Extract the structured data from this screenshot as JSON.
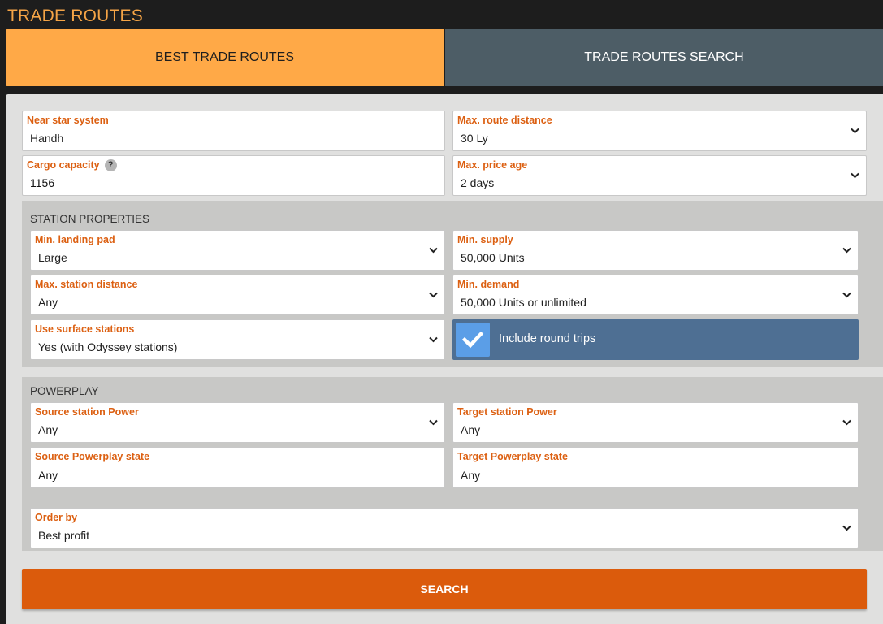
{
  "page_title": "TRADE ROUTES",
  "tabs": {
    "best": "BEST TRADE ROUTES",
    "search": "TRADE ROUTES SEARCH"
  },
  "form": {
    "near_star_system": {
      "label": "Near star system",
      "value": "Handh"
    },
    "max_route_distance": {
      "label": "Max. route distance",
      "value": "30 Ly"
    },
    "cargo_capacity": {
      "label": "Cargo capacity",
      "value": "1156",
      "help": "?"
    },
    "max_price_age": {
      "label": "Max. price age",
      "value": "2 days"
    }
  },
  "station_properties": {
    "title": "STATION PROPERTIES",
    "min_landing_pad": {
      "label": "Min. landing pad",
      "value": "Large"
    },
    "min_supply": {
      "label": "Min. supply",
      "value": "50,000 Units"
    },
    "max_station_distance": {
      "label": "Max. station distance",
      "value": "Any"
    },
    "min_demand": {
      "label": "Min. demand",
      "value": "50,000 Units or unlimited"
    },
    "use_surface_stations": {
      "label": "Use surface stations",
      "value": "Yes (with Odyssey stations)"
    },
    "include_round_trips": {
      "label": "Include round trips",
      "checked": true
    }
  },
  "powerplay": {
    "title": "POWERPLAY",
    "source_station_power": {
      "label": "Source station Power",
      "value": "Any"
    },
    "target_station_power": {
      "label": "Target station Power",
      "value": "Any"
    },
    "source_powerplay_state": {
      "label": "Source Powerplay state",
      "value": "Any"
    },
    "target_powerplay_state": {
      "label": "Target Powerplay state",
      "value": "Any"
    }
  },
  "order_by": {
    "label": "Order by",
    "value": "Best profit"
  },
  "search_button": "SEARCH",
  "colors": {
    "accent_orange": "#ffa947",
    "label_orange": "#dc6012",
    "search_button": "#db5b0c",
    "tab_inactive": "#4d5d66",
    "checkbox_bg": "#4e6f93",
    "checkbox_box": "#5b9ee7"
  }
}
